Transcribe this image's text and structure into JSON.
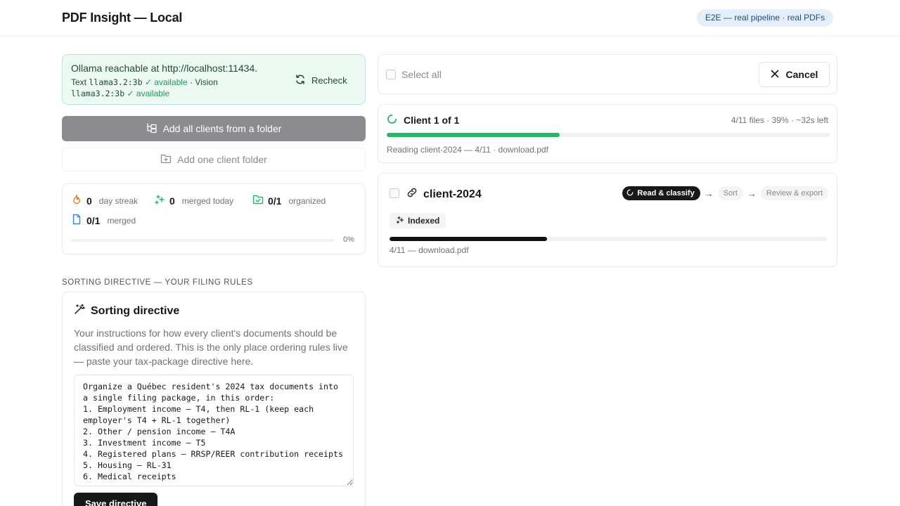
{
  "header": {
    "title": "PDF Insight — Local",
    "badge": "E2E — real pipeline · real PDFs"
  },
  "ollama": {
    "status_line": "Ollama reachable at http://localhost:11434.",
    "text_prefix": "Text",
    "text_model": "llama3.2:3b",
    "text_state": "✓ available",
    "vision_prefix": "· Vision",
    "vision_model": "llama3.2:3b",
    "vision_state": "✓ available",
    "recheck_label": "Recheck"
  },
  "actions": {
    "add_all_label": "Add all clients from a folder",
    "add_one_label": "Add one client folder"
  },
  "stats": {
    "streak_value": "0",
    "streak_label": "day streak",
    "merged_today_value": "0",
    "merged_today_label": "merged today",
    "organized_value": "0/1",
    "organized_label": "organized",
    "merged_value": "0/1",
    "merged_label": "merged",
    "progress_percent": "0%",
    "progress_fraction": 0
  },
  "directive": {
    "section_label": "SORTING DIRECTIVE — YOUR FILING RULES",
    "title": "Sorting directive",
    "description": "Your instructions for how every client's documents should be classified and ordered. This is the only place ordering rules live — paste your tax-package directive here.",
    "text": "Organize a Québec resident's 2024 tax documents into a single filing package, in this order:\n1. Employment income — T4, then RL-1 (keep each employer's T4 + RL-1 together)\n2. Other / pension income — T4A\n3. Investment income — T5\n4. Registered plans — RRSP/REER contribution receipts\n5. Housing — RL-31\n6. Medical receipts",
    "save_label": "Save directive"
  },
  "selection": {
    "select_all_label": "Select all",
    "cancel_label": "Cancel"
  },
  "progress": {
    "title": "Client 1 of 1",
    "meta": "4/11 files · 39% · ~32s left",
    "fraction": 0.39,
    "status": "Reading client-2024 — 4/11 · download.pdf"
  },
  "client": {
    "name": "client-2024",
    "steps": {
      "active": "Read & classify",
      "sort": "Sort",
      "review": "Review & export"
    },
    "badge": "Indexed",
    "fraction": 0.36,
    "status": "4/11 — download.pdf"
  },
  "colors": {
    "accent_green": "#22b863",
    "status_bg": "#ecfaf3",
    "dark": "#18181b",
    "badge_bg": "#e3f0fb"
  }
}
